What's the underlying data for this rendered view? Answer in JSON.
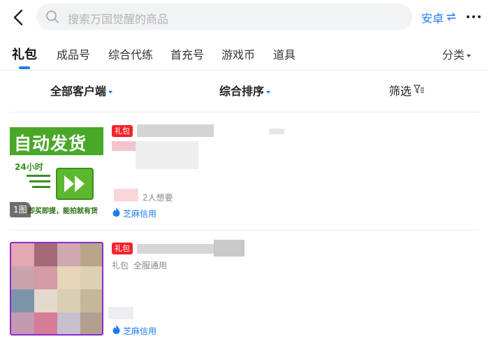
{
  "header": {
    "search_placeholder": "搜索万国觉醒的商品",
    "platform": "安卓",
    "icons": {
      "back": "back-arrow-icon",
      "search": "search-icon",
      "switch": "switch-icon",
      "more": "more-icon"
    }
  },
  "tabs": [
    {
      "label": "礼包",
      "active": true
    },
    {
      "label": "成品号"
    },
    {
      "label": "综合代练"
    },
    {
      "label": "首充号"
    },
    {
      "label": "游戏币"
    },
    {
      "label": "道具"
    }
  ],
  "category_button": "分类",
  "filters": {
    "client": "全部客户端",
    "sort": "综合排序",
    "screen": "筛选"
  },
  "products": [
    {
      "tag": "礼包",
      "thumb_headline": "自动发货",
      "thumb_24h": "24小时",
      "thumb_caption": "即买即提，能拍就有货",
      "image_count": "1图",
      "wants": "2人想要",
      "credit": "芝麻信用"
    },
    {
      "tag": "礼包",
      "category": "礼包",
      "server": "全服通用",
      "credit": "芝麻信用"
    }
  ],
  "colors": {
    "accent": "#1d7bf5",
    "tag": "#f5222d",
    "thumb_green": "#4aa829"
  }
}
